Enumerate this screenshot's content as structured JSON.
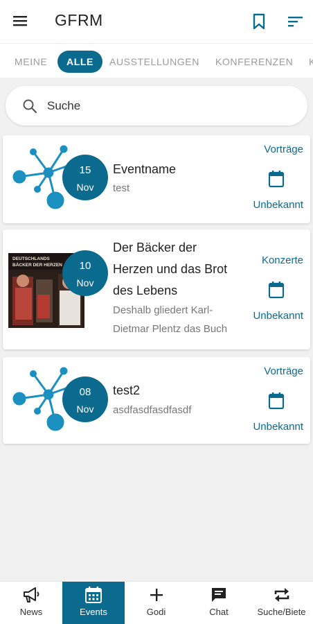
{
  "app": {
    "title": "GFRM"
  },
  "tabs": [
    {
      "label": "MEINE",
      "active": false
    },
    {
      "label": "ALLE",
      "active": true
    },
    {
      "label": "AUSSTELLUNGEN",
      "active": false
    },
    {
      "label": "KONFERENZEN",
      "active": false
    },
    {
      "label": "K",
      "active": false
    }
  ],
  "search": {
    "placeholder": "Suche",
    "value": ""
  },
  "events": [
    {
      "day": "15",
      "month": "Nov",
      "name": "Eventname",
      "description": "test",
      "category": "Vorträge",
      "status": "Unbekannt",
      "thumb_type": "logo"
    },
    {
      "day": "10",
      "month": "Nov",
      "name_lines": [
        "Der Bäcker der",
        "Herzen und das Brot",
        "des Lebens"
      ],
      "description_lines": [
        "Deshalb gliedert Karl-",
        "Dietmar Plentz das Buch"
      ],
      "category": "Konzerte",
      "status": "Unbekannt",
      "thumb_type": "photo",
      "photo_text": [
        "DEUTSCHLANDS",
        "BÄCKER DER HERZEN"
      ]
    },
    {
      "day": "08",
      "month": "Nov",
      "name": "test2",
      "description": "asdfasdfasdfasdf",
      "category": "Vorträge",
      "status": "Unbekannt",
      "thumb_type": "logo"
    }
  ],
  "bottom_nav": [
    {
      "label": "News",
      "icon": "megaphone-icon",
      "active": false
    },
    {
      "label": "Events",
      "icon": "calendar-icon",
      "active": true
    },
    {
      "label": "Godi",
      "icon": "plus-icon",
      "active": false
    },
    {
      "label": "Chat",
      "icon": "chat-icon",
      "active": false
    },
    {
      "label": "Suche/Biete",
      "icon": "swap-icon",
      "active": false
    }
  ],
  "colors": {
    "accent": "#0b6b8e",
    "logo": "#1a8fc0",
    "background": "#f1f1f1"
  }
}
